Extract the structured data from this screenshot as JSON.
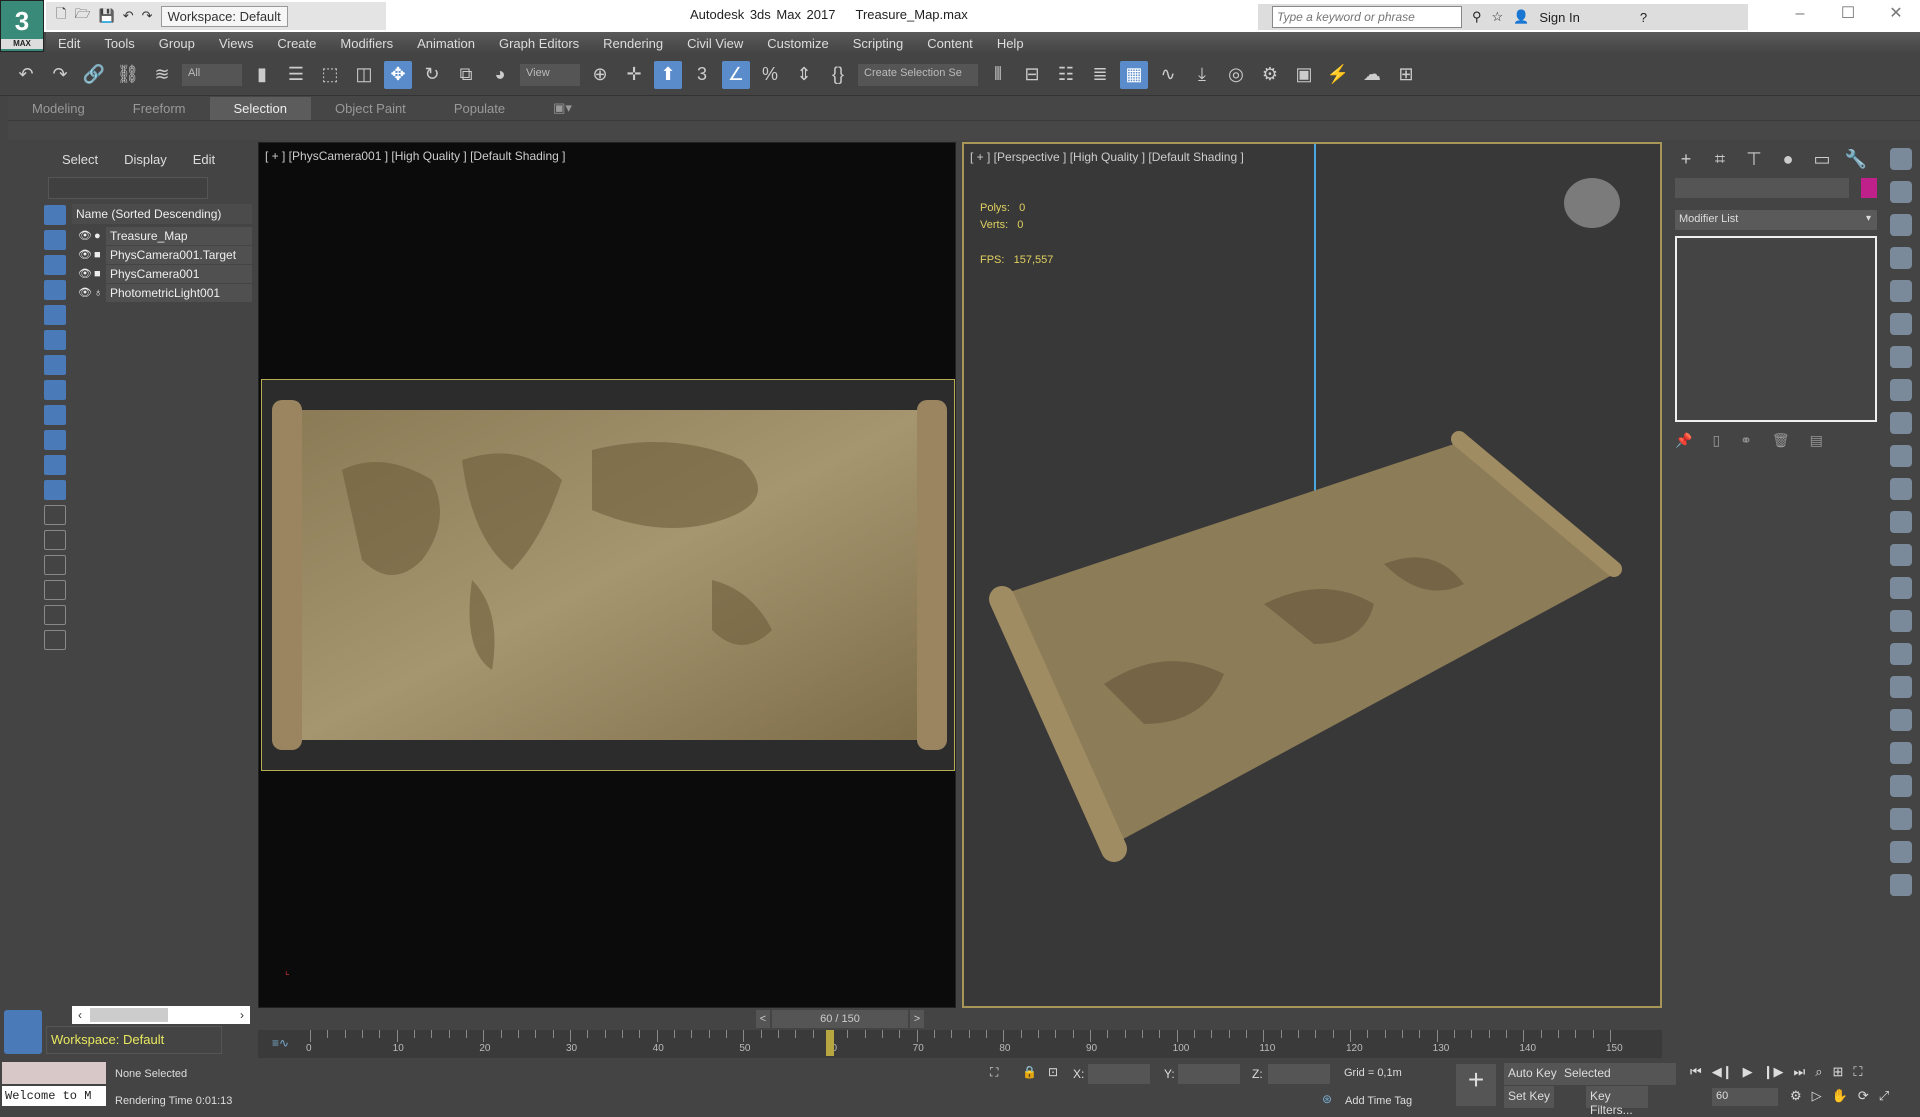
{
  "app": {
    "logo": "3",
    "logo_sub": "MAX",
    "title": "Autodesk 3ds Max 2017",
    "file": "Treasure_Map.max",
    "workspace": "Workspace: Default"
  },
  "search": {
    "placeholder": "Type a keyword or phrase",
    "sign_in": "Sign In"
  },
  "menu": [
    "Edit",
    "Tools",
    "Group",
    "Views",
    "Create",
    "Modifiers",
    "Animation",
    "Graph Editors",
    "Rendering",
    "Civil View",
    "Customize",
    "Scripting",
    "Content",
    "Help"
  ],
  "toolbar": {
    "filter": "All",
    "ref_coord": "View",
    "selection_set": "Create Selection Se"
  },
  "ribbon": {
    "tabs": [
      "Modeling",
      "Freeform",
      "Selection",
      "Object Paint",
      "Populate"
    ],
    "active": "Selection"
  },
  "explorer": {
    "menu": [
      "Select",
      "Display",
      "Edit"
    ],
    "header": "Name (Sorted Descending)",
    "items": [
      "Treasure_Map",
      "PhysCamera001.Target",
      "PhysCamera001",
      "PhotometricLight001"
    ]
  },
  "viewports": {
    "left": {
      "label": "[ + ] [PhysCamera001 ] [High Quality ] [Default Shading ]"
    },
    "right": {
      "label": "[ + ] [Perspective ] [High Quality ] [Default Shading ]",
      "polys_label": "Polys:",
      "polys": "0",
      "verts_label": "Verts:",
      "verts": "0",
      "fps_label": "FPS:",
      "fps": "157,557"
    }
  },
  "command_panel": {
    "modifier_list": "Modifier List",
    "color": "#c0208a"
  },
  "timeline": {
    "frame_display": "60 / 150",
    "current": 60,
    "max": 150,
    "ticks": [
      "0",
      "10",
      "20",
      "30",
      "40",
      "50",
      "60",
      "70",
      "80",
      "90",
      "100",
      "110",
      "120",
      "130",
      "140",
      "150"
    ]
  },
  "status": {
    "maxscript": "Welcome to M",
    "selection": "None Selected",
    "render_time": "Rendering Time  0:01:13",
    "x_label": "X:",
    "y_label": "Y:",
    "z_label": "Z:",
    "grid": "Grid = 0,1m",
    "add_time_tag": "Add Time Tag",
    "auto_key": "Auto Key",
    "set_key": "Set Key",
    "key_mode": "Selected",
    "key_filters": "Key Filters...",
    "frame": "60"
  },
  "bottom_workspace": "Workspace: Default"
}
